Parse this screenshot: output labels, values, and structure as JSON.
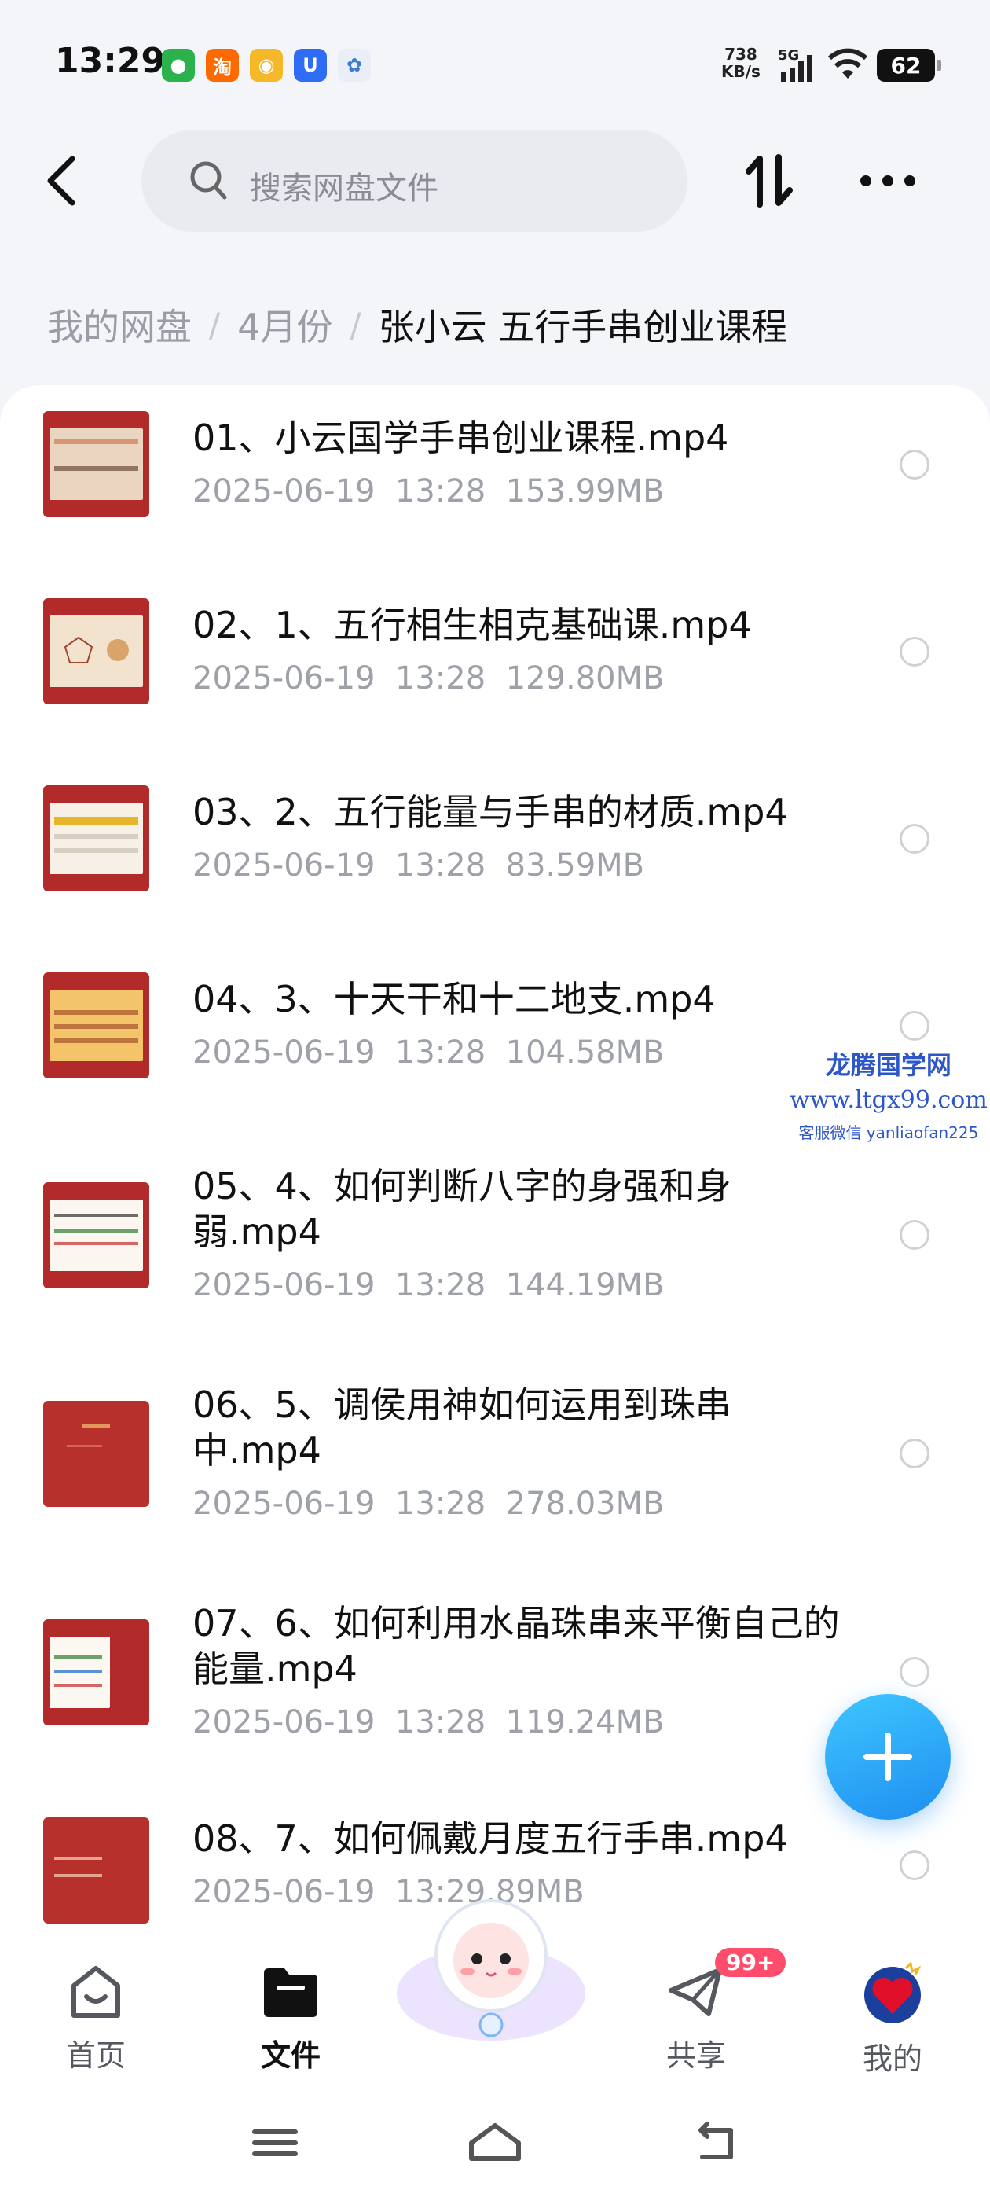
{
  "status_bar": {
    "time": "13:29",
    "net_speed_value": "738",
    "net_speed_unit": "KB/s",
    "signal_label": "5G",
    "battery": "62",
    "app_icons": [
      "wechat-icon",
      "taobao-icon",
      "bulb-app-icon",
      "u-app-icon",
      "cloud-app-icon"
    ]
  },
  "header": {
    "search_placeholder": "搜索网盘文件"
  },
  "breadcrumb": {
    "items": [
      "我的网盘",
      "4月份"
    ],
    "current": "张小云 五行手串创业课程"
  },
  "files": [
    {
      "name": "01、小云国学手串创业课程.mp4",
      "date": "2025-06-19",
      "time": "13:28",
      "size": "153.99MB"
    },
    {
      "name": "02、1、五行相生相克基础课.mp4",
      "date": "2025-06-19",
      "time": "13:28",
      "size": "129.80MB"
    },
    {
      "name": "03、2、五行能量与手串的材质.mp4",
      "date": "2025-06-19",
      "time": "13:28",
      "size": "83.59MB"
    },
    {
      "name": "04、3、十天干和十二地支.mp4",
      "date": "2025-06-19",
      "time": "13:28",
      "size": "104.58MB"
    },
    {
      "name": "05、4、如何判断八字的身强和身弱.mp4",
      "date": "2025-06-19",
      "time": "13:28",
      "size": "144.19MB"
    },
    {
      "name": "06、5、调侯用神如何运用到珠串中.mp4",
      "date": "2025-06-19",
      "time": "13:28",
      "size": "278.03MB"
    },
    {
      "name": "07、6、如何利用水晶珠串来平衡自己的能量.mp4",
      "date": "2025-06-19",
      "time": "13:28",
      "size": "119.24MB"
    },
    {
      "name": "08、7、如何佩戴月度五行手串.mp4",
      "date": "2025-06-19",
      "time": "13:",
      "size": "29.89MB"
    }
  ],
  "watermark": {
    "line1": "龙腾国学网",
    "line2": "www.ltgx99.com",
    "line3": "客服微信 yanliaofan225"
  },
  "bottom_nav": {
    "home": "首页",
    "files": "文件",
    "share": "共享",
    "share_badge": "99+",
    "mine": "我的"
  },
  "colors": {
    "accent_blue": "#1e8ef0",
    "badge_red": "#ff4d6b",
    "thumb_red": "#b22a2a"
  }
}
